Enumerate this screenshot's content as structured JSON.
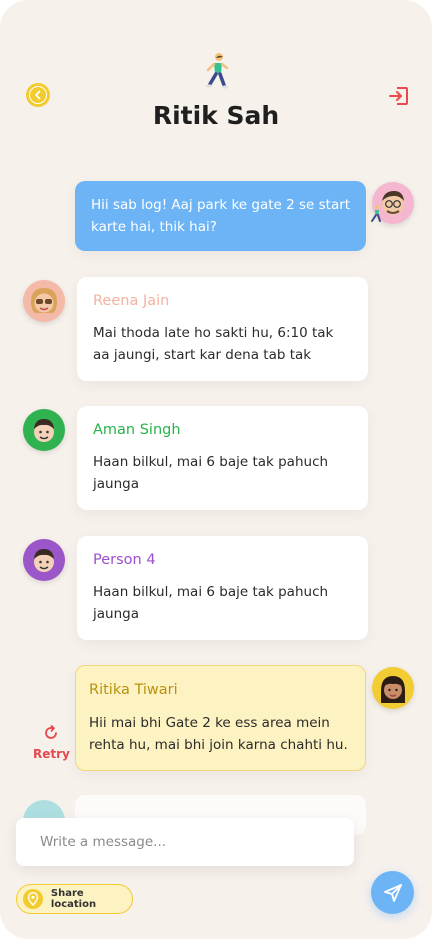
{
  "header": {
    "title": "Ritik Sah",
    "back_icon": "chevron-left-icon",
    "logout_icon": "logout-icon"
  },
  "messages": [
    {
      "sender": "",
      "text": "Hii sab log! Aaj park ke gate 2 se start karte hai, thik hai?",
      "own": true
    },
    {
      "sender": "Reena Jain",
      "text": "Mai thoda late ho sakti hu, 6:10 tak aa jaungi, start kar dena tab tak",
      "name_color": "#f4b2a0"
    },
    {
      "sender": "Aman Singh",
      "text": "Haan bilkul, mai 6 baje tak pahuch jaunga",
      "name_color": "#27b34a"
    },
    {
      "sender": "Person 4",
      "text": "Haan bilkul, mai 6 baje tak pahuch jaunga",
      "name_color": "#9b4fcf"
    },
    {
      "sender": "Ritika Tiwari",
      "text": "Hii mai bhi Gate 2 ke ess area mein rehta hu, mai bhi join karna chahti hu.",
      "name_color": "#b8920e",
      "status": "Retry"
    }
  ],
  "composer": {
    "placeholder": "Write a message...",
    "share_location": "Share location"
  },
  "colors": {
    "background": "#f7f1ec",
    "accent_blue": "#6db4f7",
    "accent_yellow": "#f2cb2f",
    "error_red": "#e5484d"
  }
}
